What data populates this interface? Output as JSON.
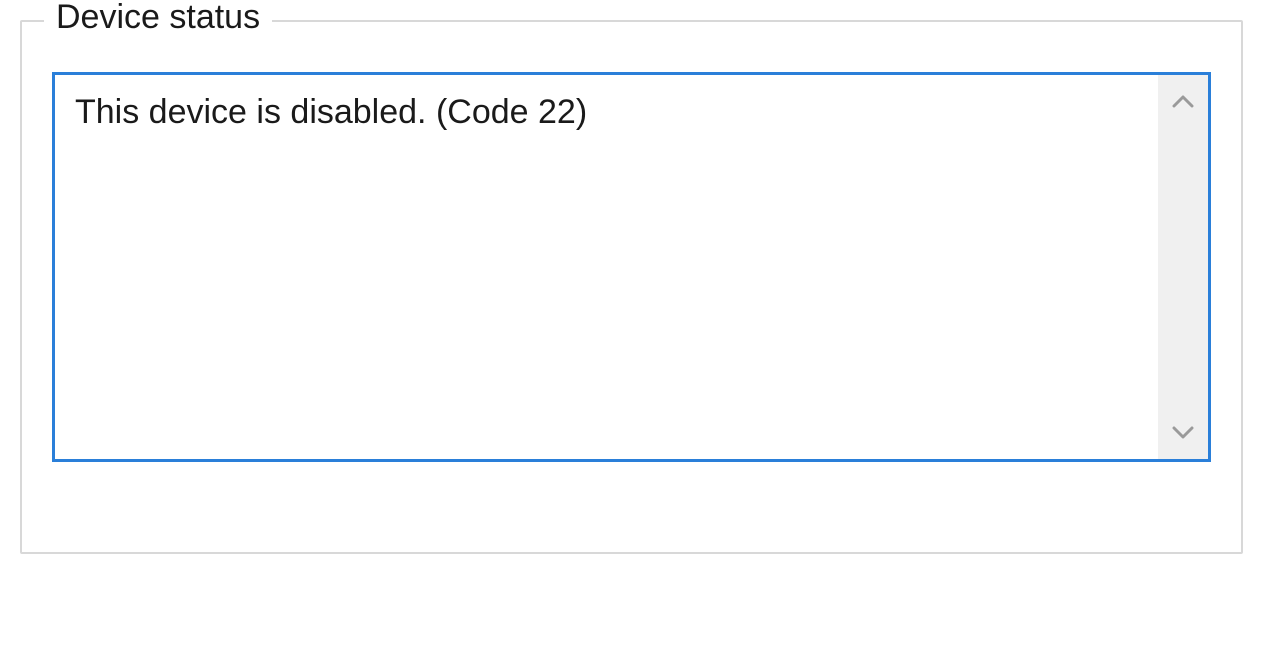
{
  "group": {
    "legend": "Device status",
    "status_message": "This device is disabled. (Code 22)"
  }
}
